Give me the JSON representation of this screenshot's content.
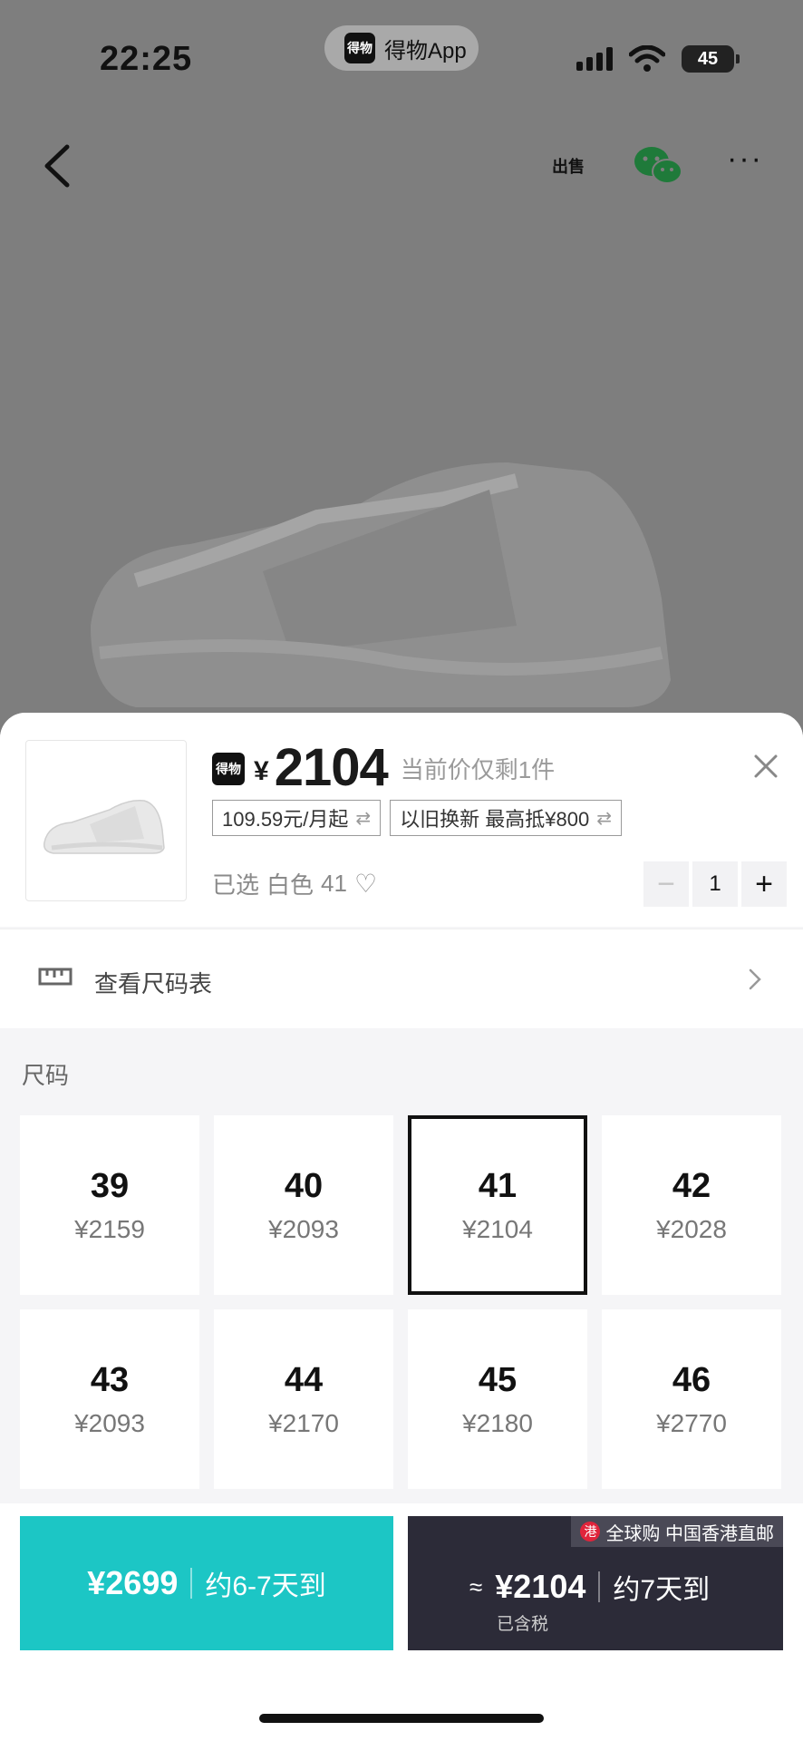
{
  "status_bar": {
    "time": "22:25",
    "app_logo_text": "得物",
    "app_name": "得物App",
    "battery": "45"
  },
  "nav": {
    "back_icon": "chevron-left-icon",
    "sell_label": "出售",
    "share_icon": "wechat-icon",
    "more_icon": "more-icon"
  },
  "product": {
    "brand_icon_text": "得物",
    "currency": "¥",
    "price": "2104",
    "price_note": "当前价仅剩1件",
    "installment_tag": "109.59元/月起",
    "tradein_tag": "以旧换新 最高抵¥800",
    "selected_label": "已选",
    "selected_color": "白色",
    "selected_size": "41",
    "quantity": "1"
  },
  "size_chart": {
    "label": "查看尺码表"
  },
  "sizes": {
    "section_label": "尺码",
    "items": [
      {
        "size": "39",
        "price": "¥2159"
      },
      {
        "size": "40",
        "price": "¥2093"
      },
      {
        "size": "41",
        "price": "¥2104"
      },
      {
        "size": "42",
        "price": "¥2028"
      },
      {
        "size": "43",
        "price": "¥2093"
      },
      {
        "size": "44",
        "price": "¥2170"
      },
      {
        "size": "45",
        "price": "¥2180"
      },
      {
        "size": "46",
        "price": "¥2770"
      }
    ],
    "selected_index": 2
  },
  "actions": {
    "fast": {
      "price": "¥2699",
      "delivery": "约6-7天到",
      "color": "#1cc6c5"
    },
    "global": {
      "badge_flag": "港",
      "badge": "全球购 中国香港直邮",
      "approx": "≈",
      "price": "¥2104",
      "delivery": "约7天到",
      "tax": "已含税",
      "color": "#2c2b38"
    }
  }
}
